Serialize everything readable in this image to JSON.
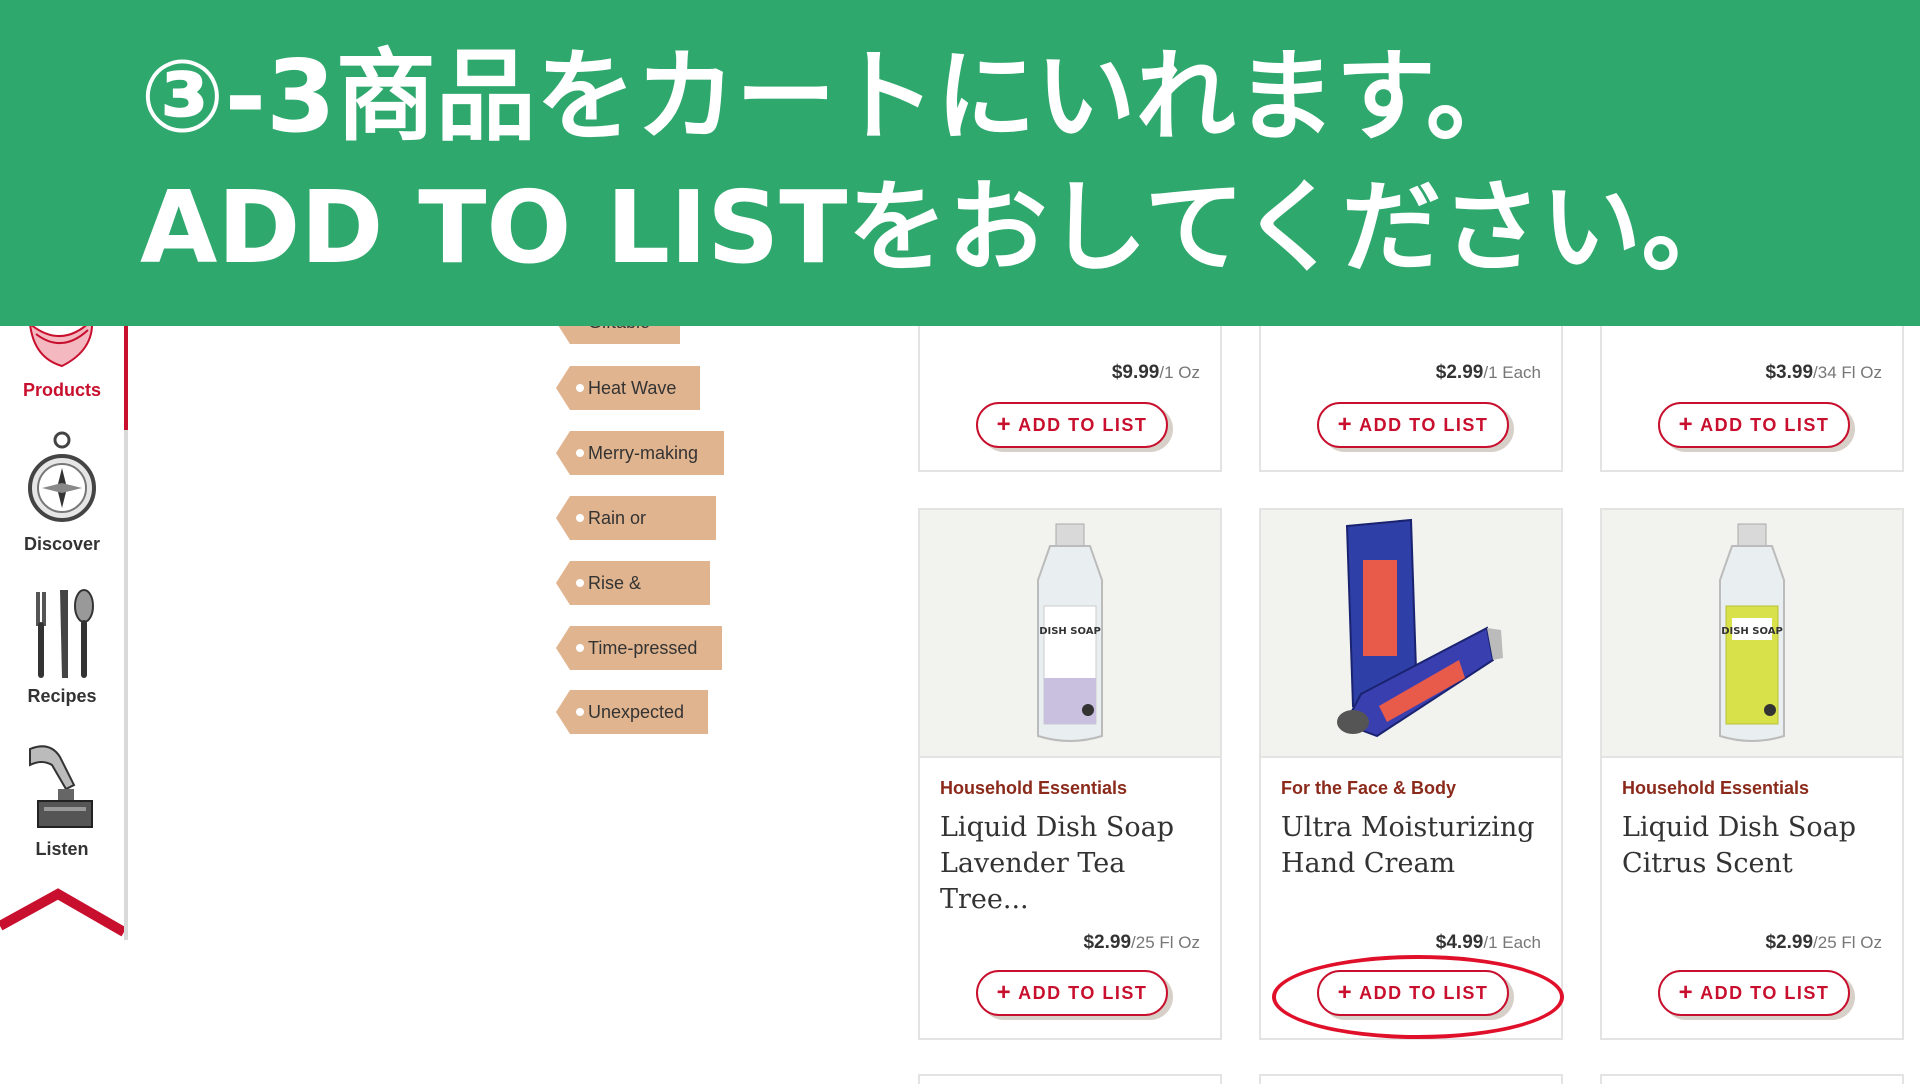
{
  "banner": {
    "line1": "③-3商品をカートにいれます。",
    "line2": "ADD TO LISTをおしてください。"
  },
  "sidebar": {
    "items": [
      {
        "label": "Products",
        "icon": "products-icon",
        "active": true
      },
      {
        "label": "Discover",
        "icon": "compass-icon"
      },
      {
        "label": "Recipes",
        "icon": "cutlery-icon"
      },
      {
        "label": "Listen",
        "icon": "gramophone-icon"
      }
    ],
    "accent_color": "#c8102e"
  },
  "tags": {
    "partial": "Giftable",
    "items": [
      "Heat Wave",
      "Merry-making",
      "Rain or Shine",
      "Rise & Shine",
      "Time-pressed",
      "Unexpected"
    ]
  },
  "top_row": [
    {
      "price": "$9.99",
      "unit": "/1 Oz",
      "button": "ADD TO LIST"
    },
    {
      "price": "$2.99",
      "unit": "/1 Each",
      "button": "ADD TO LIST"
    },
    {
      "price": "$3.99",
      "unit": "/34 Fl Oz",
      "button": "ADD TO LIST"
    }
  ],
  "products": [
    {
      "category": "Household Essentials",
      "name": "Liquid Dish Soap Lavender Tea Tree...",
      "price": "$2.99",
      "unit": "/25 Fl Oz",
      "button": "ADD TO LIST",
      "image": "dish-soap-lavender-image"
    },
    {
      "category": "For the Face & Body",
      "name": "Ultra Moisturizing Hand Cream",
      "price": "$4.99",
      "unit": "/1 Each",
      "button": "ADD TO LIST",
      "image": "hand-cream-image"
    },
    {
      "category": "Household Essentials",
      "name": "Liquid Dish Soap Citrus Scent",
      "price": "$2.99",
      "unit": "/25 Fl Oz",
      "button": "ADD TO LIST",
      "image": "dish-soap-citrus-image"
    }
  ]
}
